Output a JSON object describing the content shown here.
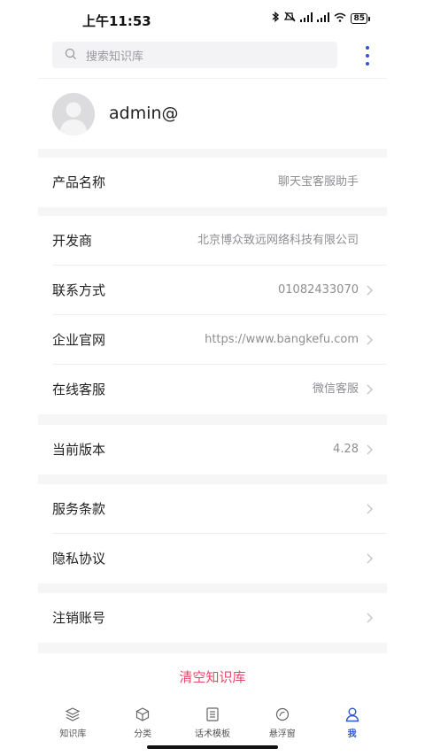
{
  "status_bar": {
    "time": "上午11:53",
    "battery": "85"
  },
  "search": {
    "placeholder": "搜索知识库"
  },
  "profile": {
    "username": "admin@"
  },
  "rows": [
    {
      "label": "产品名称",
      "value": "聊天宝客服助手"
    },
    {
      "label": "开发商",
      "value": "北京博众致远网络科技有限公司"
    },
    {
      "label": "联系方式",
      "value": "01082433070"
    },
    {
      "label": "企业官网",
      "value": "https://www.bangkefu.com"
    },
    {
      "label": "在线客服",
      "value": "微信客服"
    },
    {
      "label": "当前版本",
      "value": "4.28"
    },
    {
      "label": "服务条款",
      "value": ""
    },
    {
      "label": "隐私协议",
      "value": ""
    },
    {
      "label": "注销账号",
      "value": ""
    }
  ],
  "clear_button": "清空知识库",
  "tabs": [
    {
      "label": "知识库",
      "icon": "layers-icon",
      "active": false
    },
    {
      "label": "分类",
      "icon": "cube-icon",
      "active": false
    },
    {
      "label": "话术模板",
      "icon": "list-doc-icon",
      "active": false
    },
    {
      "label": "悬浮窗",
      "icon": "float-window-icon",
      "active": false
    },
    {
      "label": "我",
      "icon": "user-icon",
      "active": true
    }
  ],
  "colors": {
    "accent": "#2f55d4",
    "danger": "#e5486b"
  }
}
